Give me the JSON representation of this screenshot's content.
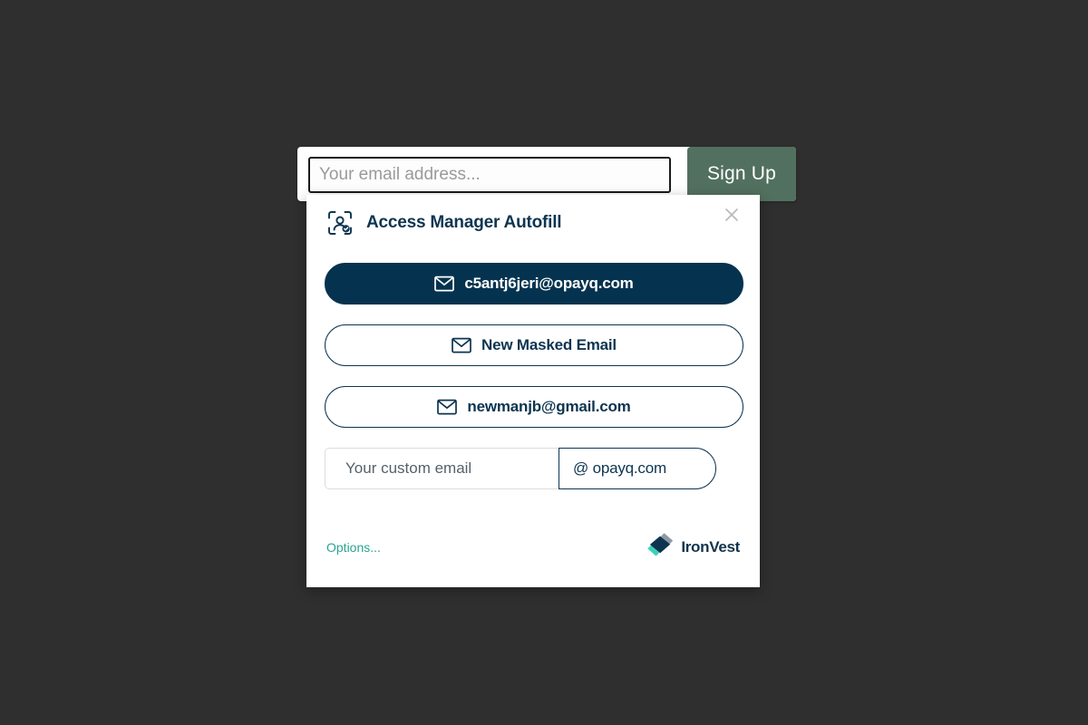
{
  "page": {
    "background_color": "#2f2f2f"
  },
  "signup_form": {
    "email_placeholder": "Your email address...",
    "email_value": "",
    "submit_label": "Sign Up",
    "submit_color": "#52705f"
  },
  "autofill_panel": {
    "title": "Access Manager Autofill",
    "title_color": "#0d3550",
    "header_icon": "identity-scan-verified-icon",
    "close_icon": "close-icon",
    "options": [
      {
        "label": "c5antj6jeri@opayq.com",
        "icon": "envelope-icon",
        "style": "primary",
        "bg_color": "#05334f",
        "text_color": "#ffffff"
      },
      {
        "label": "New Masked Email",
        "icon": "envelope-icon",
        "style": "secondary",
        "bg_color": "#ffffff",
        "text_color": "#0d3550"
      },
      {
        "label": "newmanjb@gmail.com",
        "icon": "envelope-icon",
        "style": "secondary",
        "bg_color": "#ffffff",
        "text_color": "#0d3550"
      }
    ],
    "custom_email": {
      "placeholder": "Your custom email",
      "value": "",
      "domain": "@ opayq.com"
    },
    "footer": {
      "options_label": "Options...",
      "options_color": "#29a393",
      "brand_name": "IronVest",
      "brand_logo_icon": "ironvest-diamond-logo",
      "brand_colors": {
        "teal": "#3fd0b8",
        "gray": "#8e99a4",
        "navy": "#0d3550"
      }
    }
  }
}
